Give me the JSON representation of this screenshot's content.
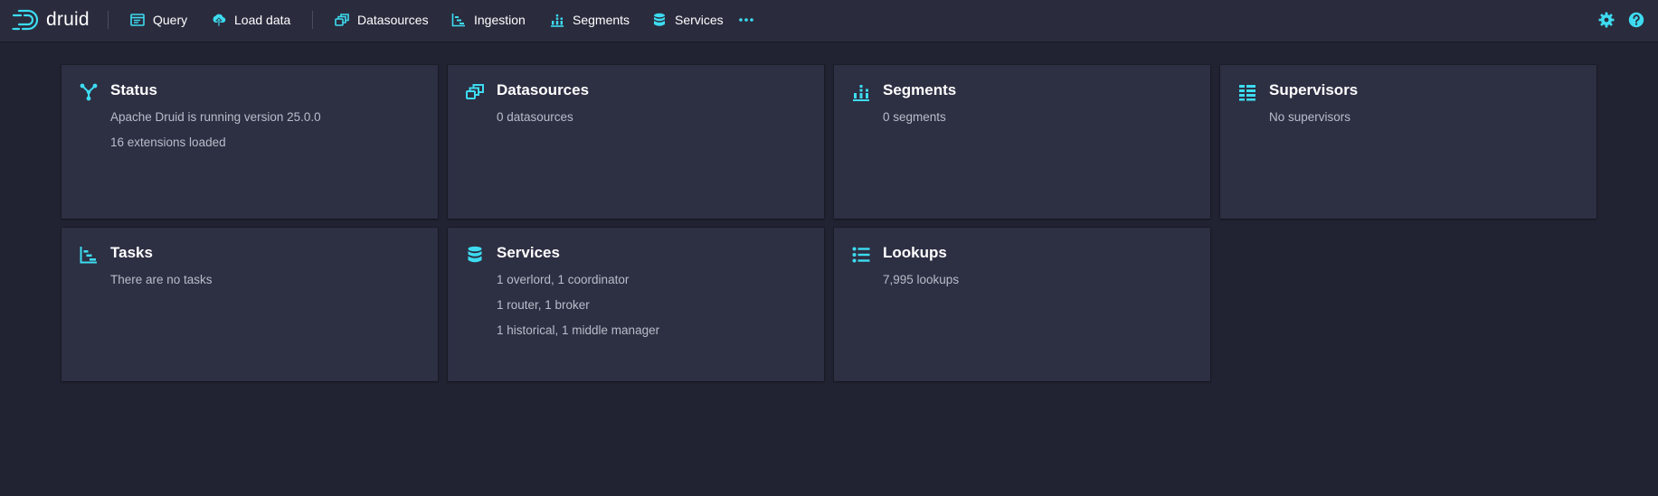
{
  "app": {
    "logo_text": "druid"
  },
  "nav": {
    "items": [
      {
        "label": "Query",
        "icon": "query-icon"
      },
      {
        "label": "Load data",
        "icon": "upload-icon"
      },
      {
        "label": "Datasources",
        "icon": "datasources-icon"
      },
      {
        "label": "Ingestion",
        "icon": "ingestion-icon"
      },
      {
        "label": "Segments",
        "icon": "segments-icon"
      },
      {
        "label": "Services",
        "icon": "database-icon"
      }
    ],
    "more_icon": "more-icon",
    "right_icons": [
      "settings-icon",
      "help-icon"
    ]
  },
  "cards": {
    "status": {
      "title": "Status",
      "lines": [
        "Apache Druid is running version 25.0.0",
        "16 extensions loaded"
      ]
    },
    "datasources": {
      "title": "Datasources",
      "lines": [
        "0 datasources"
      ]
    },
    "segments": {
      "title": "Segments",
      "lines": [
        "0 segments"
      ]
    },
    "supervisors": {
      "title": "Supervisors",
      "lines": [
        "No supervisors"
      ]
    },
    "tasks": {
      "title": "Tasks",
      "lines": [
        "There are no tasks"
      ]
    },
    "services": {
      "title": "Services",
      "lines": [
        "1 overlord, 1 coordinator",
        "1 router, 1 broker",
        "1 historical, 1 middle manager"
      ]
    },
    "lookups": {
      "title": "Lookups",
      "lines": [
        "7,995 lookups"
      ]
    }
  },
  "colors": {
    "accent": "#3ddcf0",
    "background": "#212332",
    "navbar": "#2a2c3e",
    "card": "#2d2f43",
    "text_primary": "#ffffff",
    "text_secondary": "#b9bdc9"
  }
}
